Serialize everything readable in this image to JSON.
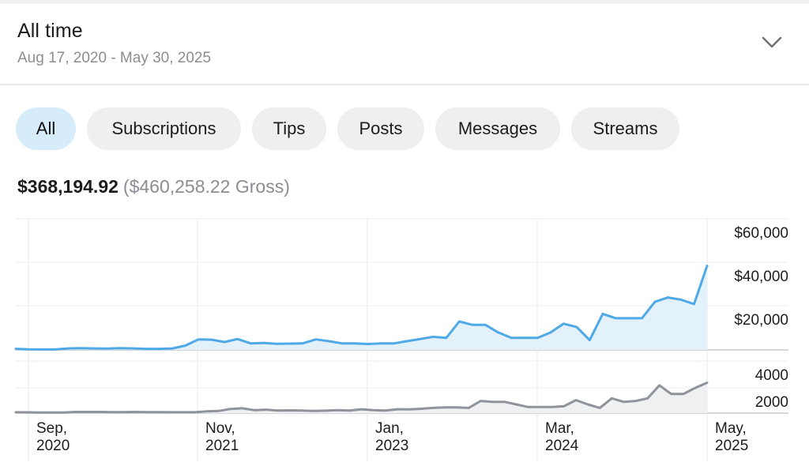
{
  "header": {
    "title": "All time",
    "date_range": "Aug 17, 2020 - May 30, 2025",
    "expand_icon": "chevron-down-icon"
  },
  "filters": {
    "chips": [
      {
        "label": "All",
        "active": true
      },
      {
        "label": "Subscriptions",
        "active": false
      },
      {
        "label": "Tips",
        "active": false
      },
      {
        "label": "Posts",
        "active": false
      },
      {
        "label": "Messages",
        "active": false
      },
      {
        "label": "Streams",
        "active": false
      }
    ]
  },
  "summary": {
    "net": "$368,194.92",
    "gross": "($460,258.22 Gross)"
  },
  "colors": {
    "line_top": "#4ea9e6",
    "fill_top": "#e3f1fb",
    "line_bottom": "#8f939a",
    "fill_bottom": "#eef0f2",
    "chip_active": "#d6ecfb",
    "chip": "#eeeff1"
  },
  "chart_data": [
    {
      "type": "area",
      "x_ticks": [
        "Sep,\n2020",
        "Nov,\n2021",
        "Jan,\n2023",
        "Mar,\n2024",
        "May,\n2025"
      ],
      "y_ticks": [
        "$60,000",
        "$40,000",
        "$20,000"
      ],
      "ylim": [
        0,
        60000
      ],
      "grid": true,
      "values": [
        500,
        300,
        200,
        200,
        700,
        800,
        700,
        600,
        800,
        700,
        500,
        500,
        700,
        2000,
        4800,
        4700,
        3600,
        5000,
        3000,
        3200,
        2800,
        2900,
        3000,
        4800,
        4000,
        3000,
        3000,
        2700,
        3000,
        3000,
        4000,
        5000,
        6000,
        5500,
        13000,
        11500,
        11500,
        8000,
        5500,
        5500,
        5500,
        8000,
        12000,
        10500,
        4500,
        16500,
        14500,
        14500,
        14500,
        22000,
        24000,
        23000,
        21000,
        38500
      ]
    },
    {
      "type": "area",
      "y_ticks": [
        "4000",
        "2000"
      ],
      "ylim": [
        0,
        6000
      ],
      "grid": true,
      "values": [
        100,
        90,
        60,
        60,
        60,
        140,
        140,
        140,
        120,
        120,
        140,
        120,
        120,
        100,
        100,
        100,
        200,
        250,
        480,
        550,
        350,
        400,
        300,
        320,
        300,
        250,
        280,
        350,
        300,
        450,
        350,
        300,
        450,
        430,
        500,
        600,
        650,
        650,
        600,
        1400,
        1300,
        1300,
        1000,
        700,
        700,
        700,
        800,
        1500,
        1000,
        600,
        1700,
        1300,
        1400,
        1700,
        3200,
        2200,
        2200,
        2900,
        3500
      ]
    }
  ]
}
